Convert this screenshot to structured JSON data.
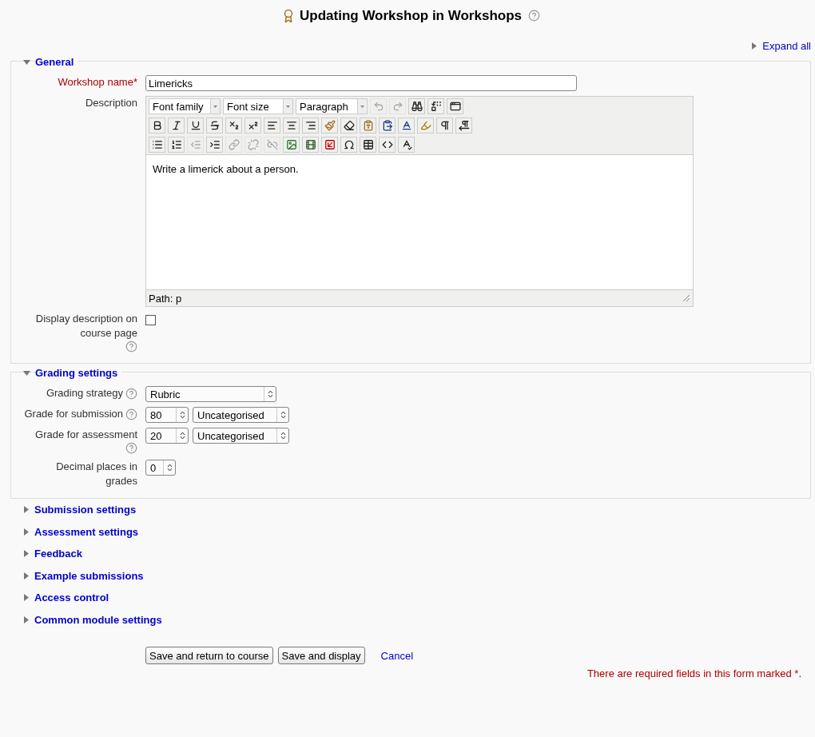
{
  "title": "Updating Workshop in Workshops",
  "expand_all": "Expand all",
  "sections": [
    {
      "title": "General",
      "expanded": true,
      "fields": [
        {
          "kind": "text",
          "label": "Workshop name",
          "required": true,
          "help": false,
          "value": "Limericks"
        },
        {
          "kind": "editor",
          "label": "Description",
          "help": false,
          "dropdowns": [
            "Font family",
            "Font size",
            "Paragraph"
          ],
          "toolbar_rows": [
            [
              {
                "kind": "undo",
                "disabled": true
              },
              {
                "kind": "redo",
                "disabled": true
              },
              {
                "kind": "find",
                "disabled": false
              },
              {
                "kind": "replace",
                "disabled": false
              },
              {
                "kind": "fullscreen",
                "disabled": false
              }
            ],
            [
              {
                "kind": "bold",
                "disabled": false
              },
              {
                "kind": "italic",
                "disabled": false
              },
              {
                "kind": "underline",
                "disabled": false
              },
              {
                "kind": "strike",
                "disabled": false
              },
              {
                "kind": "sub",
                "disabled": false
              },
              {
                "kind": "sup",
                "disabled": false
              },
              {
                "kind": "alignleft",
                "disabled": false
              },
              {
                "kind": "aligncenter",
                "disabled": false
              },
              {
                "kind": "alignright",
                "disabled": false
              },
              {
                "kind": "cleanup",
                "disabled": false
              },
              {
                "kind": "eraser",
                "disabled": false
              },
              {
                "kind": "pastetext",
                "disabled": false
              },
              {
                "kind": "pasteword",
                "disabled": false
              },
              {
                "kind": "forecolor",
                "disabled": false
              },
              {
                "kind": "highlight",
                "disabled": false
              },
              {
                "kind": "ltr",
                "disabled": false
              },
              {
                "kind": "rtl",
                "disabled": false
              }
            ],
            [
              {
                "kind": "bullist",
                "disabled": false
              },
              {
                "kind": "numlist",
                "disabled": false
              },
              {
                "kind": "outdent",
                "disabled": true
              },
              {
                "kind": "indent",
                "disabled": false
              },
              {
                "kind": "link",
                "disabled": true
              },
              {
                "kind": "unlink",
                "disabled": true
              },
              {
                "kind": "nolink",
                "disabled": true
              },
              {
                "kind": "image",
                "disabled": false
              },
              {
                "kind": "media",
                "disabled": false
              },
              {
                "kind": "embed",
                "disabled": false
              },
              {
                "kind": "charmap",
                "disabled": false
              },
              {
                "kind": "table",
                "disabled": false
              },
              {
                "kind": "html",
                "disabled": false
              },
              {
                "kind": "spell",
                "disabled": false
              }
            ]
          ],
          "content": "Write a limerick about a person.",
          "path": "Path: p"
        },
        {
          "kind": "checkbox",
          "label": "Display description on course page",
          "help": true,
          "checked": false
        }
      ]
    },
    {
      "title": "Grading settings",
      "expanded": true,
      "fields": [
        {
          "kind": "select",
          "label": "Grading strategy",
          "help": true,
          "value": "Rubric"
        },
        {
          "kind": "grade",
          "label": "Grade for submission",
          "help": true,
          "value": "80",
          "category": "Uncategorised"
        },
        {
          "kind": "grade",
          "label": "Grade for assessment",
          "help": true,
          "value": "20",
          "category": "Uncategorised"
        },
        {
          "kind": "small_select",
          "label": "Decimal places in grades",
          "help": false,
          "value": "0"
        }
      ]
    },
    {
      "title": "Submission settings",
      "expanded": false
    },
    {
      "title": "Assessment settings",
      "expanded": false
    },
    {
      "title": "Feedback",
      "expanded": false
    },
    {
      "title": "Example submissions",
      "expanded": false
    },
    {
      "title": "Access control",
      "expanded": false
    },
    {
      "title": "Common module settings",
      "expanded": false
    }
  ],
  "buttons": [
    "Save and return to course",
    "Save and display"
  ],
  "cancel": "Cancel",
  "required_note": "There are required fields in this form marked",
  "required_mark": "*",
  "required_note_end": "."
}
